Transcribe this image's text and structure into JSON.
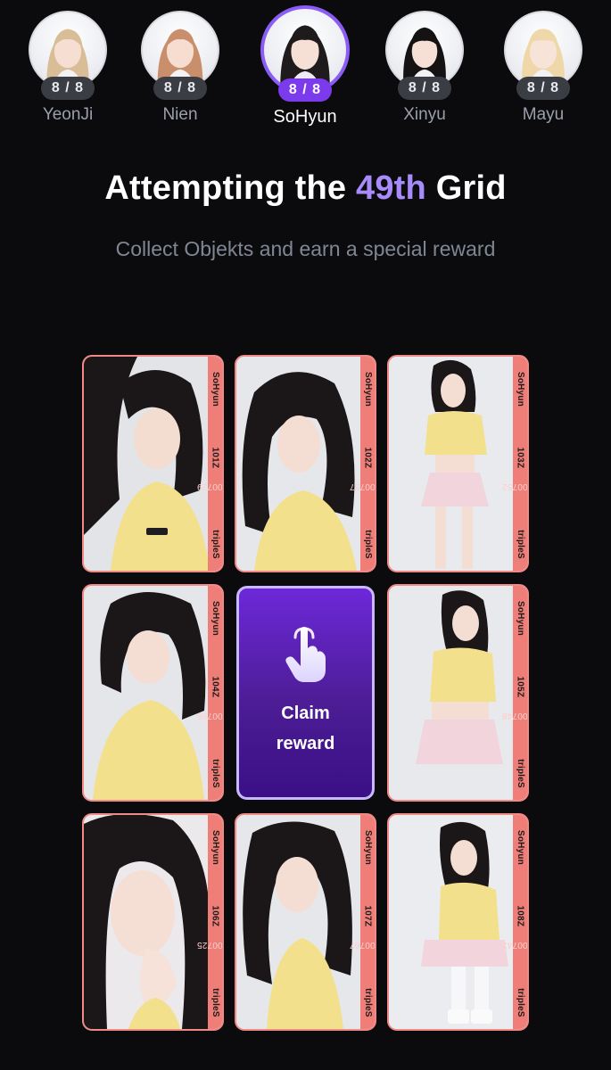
{
  "members": [
    {
      "name": "YeonJi",
      "count": "8 / 8",
      "active": false,
      "hair": "#d8bd97"
    },
    {
      "name": "Nien",
      "count": "8 / 8",
      "active": false,
      "hair": "#c98e6c"
    },
    {
      "name": "SoHyun",
      "count": "8 / 8",
      "active": true,
      "hair": "#1f1a1c"
    },
    {
      "name": "Xinyu",
      "count": "8 / 8",
      "active": false,
      "hair": "#151214"
    },
    {
      "name": "Mayu",
      "count": "8 / 8",
      "active": false,
      "hair": "#eed7a8"
    }
  ],
  "heading": {
    "title_prefix": "Attempting the ",
    "title_accent": "49th",
    "title_suffix": " Grid",
    "subtitle": "Collect Objekts and earn a special reward"
  },
  "grid": {
    "claim": {
      "line1": "Claim",
      "line2": "reward",
      "icon": "tap-hand-icon"
    },
    "cards": [
      {
        "member": "SoHyun",
        "serial": "101Z",
        "hash": "#000729",
        "brand": "tripleS"
      },
      {
        "member": "SoHyun",
        "serial": "102Z",
        "hash": "#000757",
        "brand": "tripleS"
      },
      {
        "member": "SoHyun",
        "serial": "103Z",
        "hash": "#000752",
        "brand": "tripleS"
      },
      {
        "member": "SoHyun",
        "serial": "104Z",
        "hash": "#000786",
        "brand": "tripleS"
      },
      {
        "member": "SoHyun",
        "serial": "105Z",
        "hash": "#000748",
        "brand": "tripleS"
      },
      {
        "member": "SoHyun",
        "serial": "106Z",
        "hash": "#000725",
        "brand": "tripleS"
      },
      {
        "member": "SoHyun",
        "serial": "107Z",
        "hash": "#000767",
        "brand": "tripleS"
      },
      {
        "member": "SoHyun",
        "serial": "108Z",
        "hash": "#000742",
        "brand": "tripleS"
      }
    ]
  },
  "colors": {
    "accent": "#a78bfa",
    "active_pill": "#7c3aed",
    "card_band": "#ef7e78",
    "claim_bg": "#4c1d95"
  }
}
